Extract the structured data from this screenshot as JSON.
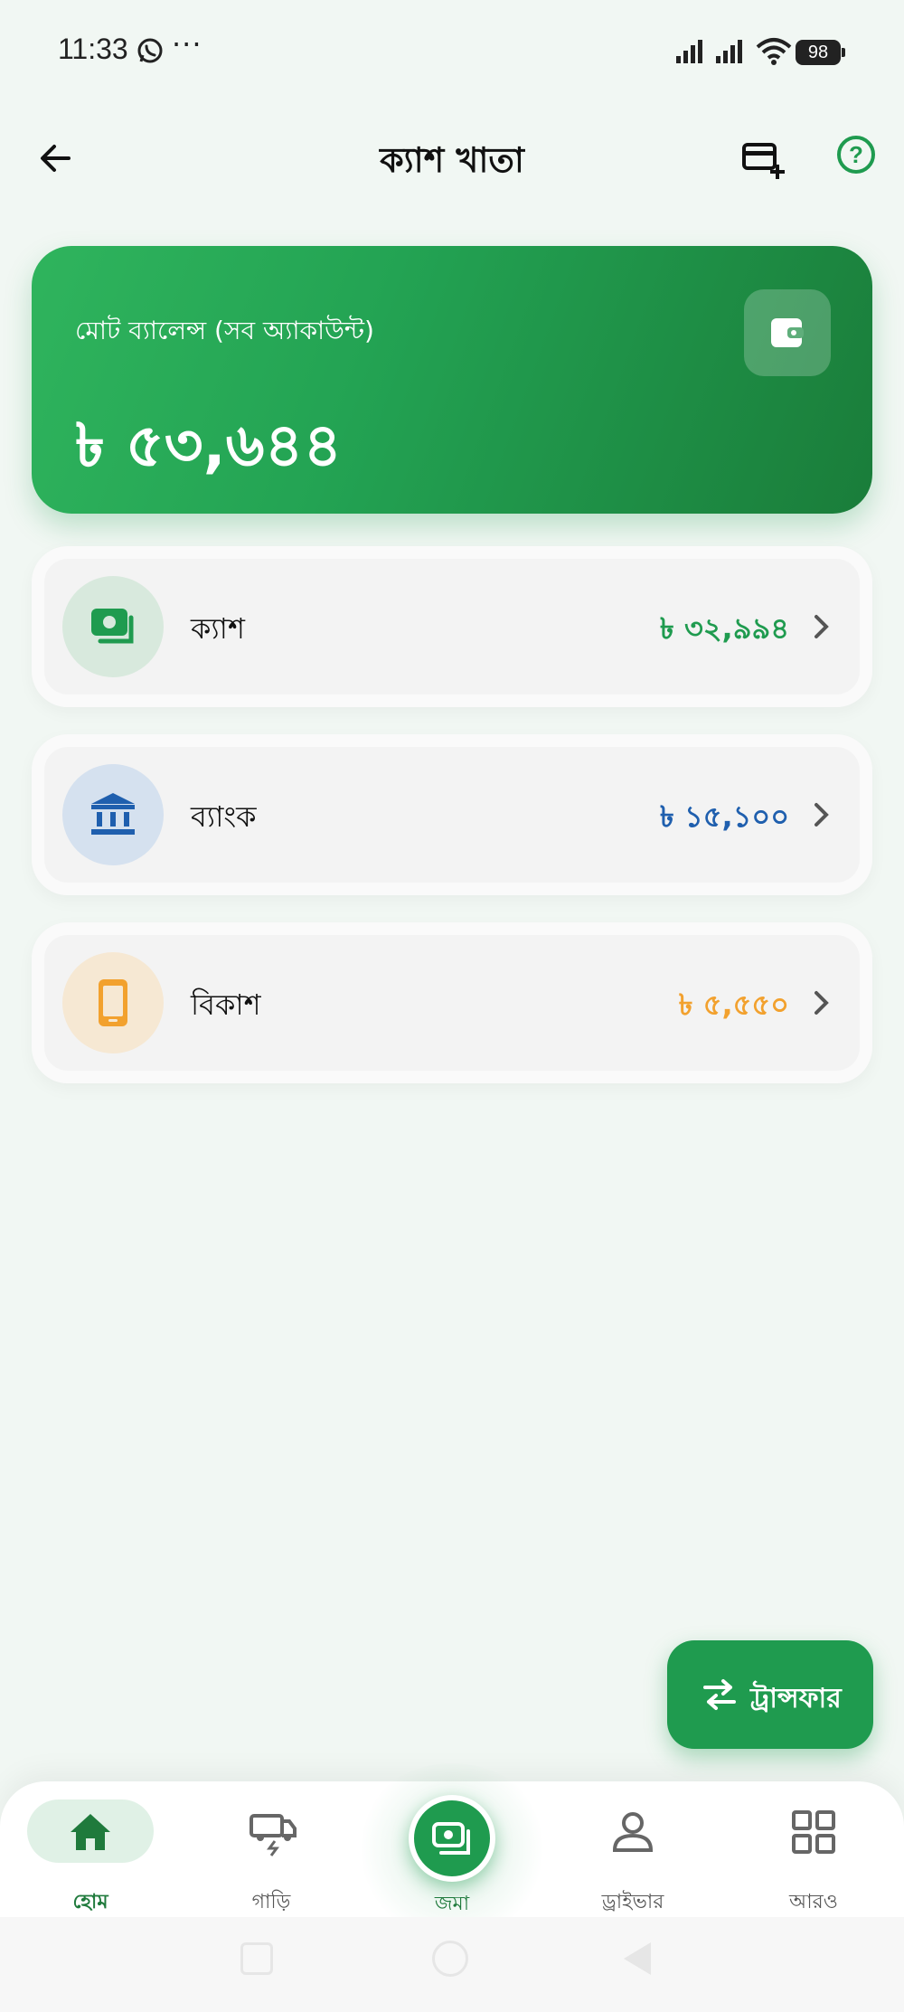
{
  "status_bar": {
    "time": "11:33",
    "dots": "···",
    "battery": "98"
  },
  "header": {
    "title": "ক্যাশ খাতা"
  },
  "balance_card": {
    "label": "মোট ব্যালেন্স (সব অ্যাকাউন্ট)",
    "amount": "৳ ৫৩,৬৪৪"
  },
  "accounts": [
    {
      "name": "ক্যাশ",
      "amount": "৳ ৩২,৯৯৪",
      "color": "#1f9b4f",
      "icon": "cash-icon"
    },
    {
      "name": "ব্যাংক",
      "amount": "৳ ১৫,১০০",
      "color": "#1f5fae",
      "icon": "bank-icon"
    },
    {
      "name": "বিকাশ",
      "amount": "৳ ৫,৫৫০",
      "color": "#f2a12e",
      "icon": "phone-icon"
    }
  ],
  "transfer_button": {
    "label": "ট্রান্সফার"
  },
  "bottom_nav": {
    "home": "হোম",
    "vehicle": "গাড়ি",
    "deposit": "জমা",
    "driver": "ড্রাইভার",
    "more": "আরও"
  },
  "colors": {
    "brand": "#1f9b4f",
    "bank": "#1f5fae",
    "bkash": "#f2a12e"
  }
}
